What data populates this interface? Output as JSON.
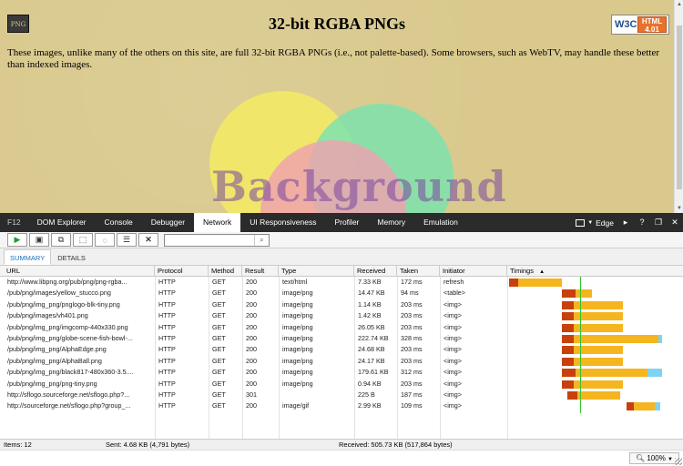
{
  "webpage": {
    "logo_text": "PNG",
    "title": "32-bit RGBA PNGs",
    "badge_left": "W3C",
    "badge_right": "HTML 4.01",
    "intro": "These images, unlike many of the others on this site, are full 32-bit RGBA PNGs (i.e., not palette-based). Some browsers, such as WebTV, may handle these better than indexed images.",
    "background_word": "Background"
  },
  "devtools": {
    "tabs": [
      "F12",
      "DOM Explorer",
      "Console",
      "Debugger",
      "Network",
      "UI Responsiveness",
      "Profiler",
      "Memory",
      "Emulation"
    ],
    "active_tab": "Network",
    "document_mode": "Edge",
    "controls": [
      "console-icon",
      "help-icon",
      "undock-icon",
      "close-icon"
    ]
  },
  "toolbar": {
    "buttons": [
      "start-profiling-icon",
      "export-icon",
      "always-refresh-icon",
      "clear-cache-icon",
      "clear-cookies-icon",
      "clear-entries-icon",
      "stop-icon"
    ],
    "search_value": ""
  },
  "subtabs": [
    "SUMMARY",
    "DETAILS"
  ],
  "active_subtab": "SUMMARY",
  "columns": [
    "URL",
    "Protocol",
    "Method",
    "Result",
    "Type",
    "Received",
    "Taken",
    "Initiator",
    "Timings"
  ],
  "rows": [
    {
      "url": "http://www.libpng.org/pub/png/png-rgba...",
      "protocol": "HTTP",
      "method": "GET",
      "result": "200",
      "type": "text/html",
      "received": "7.33 KB",
      "taken": "172 ms",
      "initiator": "refresh",
      "timing": [
        0,
        0.05,
        0.25
      ]
    },
    {
      "url": "/pub/png/images/yellow_stucco.png",
      "protocol": "HTTP",
      "method": "GET",
      "result": "200",
      "type": "image/png",
      "received": "14.47 KB",
      "taken": "94 ms",
      "initiator": "<table>",
      "timing": [
        0.3,
        0.08,
        0.09
      ]
    },
    {
      "url": "/pub/png/img_png/pnglogo-blk-tiny.png",
      "protocol": "HTTP",
      "method": "GET",
      "result": "200",
      "type": "image/png",
      "received": "1.14 KB",
      "taken": "203 ms",
      "initiator": "<img>",
      "timing": [
        0.3,
        0.07,
        0.28
      ]
    },
    {
      "url": "/pub/png/images/vh401.png",
      "protocol": "HTTP",
      "method": "GET",
      "result": "200",
      "type": "image/png",
      "received": "1.42 KB",
      "taken": "203 ms",
      "initiator": "<img>",
      "timing": [
        0.3,
        0.07,
        0.28
      ]
    },
    {
      "url": "/pub/png/img_png/imgcomp-440x330.png",
      "protocol": "HTTP",
      "method": "GET",
      "result": "200",
      "type": "image/png",
      "received": "26.05 KB",
      "taken": "203 ms",
      "initiator": "<img>",
      "timing": [
        0.3,
        0.07,
        0.28
      ]
    },
    {
      "url": "/pub/png/img_png/globe-scene-fish-bowl-...",
      "protocol": "HTTP",
      "method": "GET",
      "result": "200",
      "type": "image/png",
      "received": "222.74 KB",
      "taken": "328 ms",
      "initiator": "<img>",
      "timing": [
        0.3,
        0.07,
        0.48,
        0.02
      ]
    },
    {
      "url": "/pub/png/img_png/AlphaEdge.png",
      "protocol": "HTTP",
      "method": "GET",
      "result": "200",
      "type": "image/png",
      "received": "24.68 KB",
      "taken": "203 ms",
      "initiator": "<img>",
      "timing": [
        0.3,
        0.07,
        0.28
      ]
    },
    {
      "url": "/pub/png/img_png/AlphaBall.png",
      "protocol": "HTTP",
      "method": "GET",
      "result": "200",
      "type": "image/png",
      "received": "24.17 KB",
      "taken": "203 ms",
      "initiator": "<img>",
      "timing": [
        0.3,
        0.07,
        0.28
      ]
    },
    {
      "url": "/pub/png/img_png/black817-480x360-3.5....",
      "protocol": "HTTP",
      "method": "GET",
      "result": "200",
      "type": "image/png",
      "received": "179.61 KB",
      "taken": "312 ms",
      "initiator": "<img>",
      "timing": [
        0.3,
        0.08,
        0.41,
        0.08
      ]
    },
    {
      "url": "/pub/png/img_png/png-tiny.png",
      "protocol": "HTTP",
      "method": "GET",
      "result": "200",
      "type": "image/png",
      "received": "0.94 KB",
      "taken": "203 ms",
      "initiator": "<img>",
      "timing": [
        0.3,
        0.07,
        0.28
      ]
    },
    {
      "url": "http://sflogo.sourceforge.net/sflogo.php?...",
      "protocol": "HTTP",
      "method": "GET",
      "result": "301",
      "type": "",
      "received": "225 B",
      "taken": "187 ms",
      "initiator": "<img>",
      "timing": [
        0.33,
        0.06,
        0.24
      ]
    },
    {
      "url": "http://sourceforge.net/sflogo.php?group_...",
      "protocol": "HTTP",
      "method": "GET",
      "result": "200",
      "type": "image/gif",
      "received": "2.99 KB",
      "taken": "109 ms",
      "initiator": "<img>",
      "timing": [
        0.67,
        0.04,
        0.12,
        0.03
      ]
    }
  ],
  "status": {
    "items": "Items: 12",
    "sent": "Sent: 4.68 KB (4,791 bytes)",
    "received": "Received: 505.73 KB (517,864 bytes)"
  },
  "zoom": "100%",
  "colors": {
    "page_bg": "#d9c98d",
    "devtools_bar": "#2b2b2b",
    "accent": "#1e6fb9",
    "timing_wait": "#c8400c",
    "timing_receive": "#f5b51f",
    "timing_extra": "#7fd3f2",
    "dom_loaded_line": "#2fc52f"
  }
}
